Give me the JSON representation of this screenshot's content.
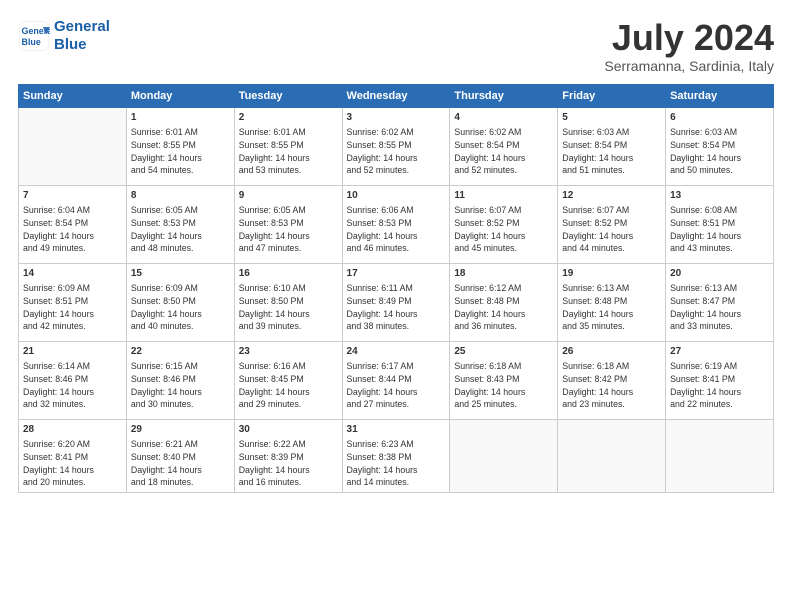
{
  "logo": {
    "line1": "General",
    "line2": "Blue"
  },
  "title": "July 2024",
  "subtitle": "Serramanna, Sardinia, Italy",
  "headers": [
    "Sunday",
    "Monday",
    "Tuesday",
    "Wednesday",
    "Thursday",
    "Friday",
    "Saturday"
  ],
  "weeks": [
    [
      {
        "day": "",
        "text": ""
      },
      {
        "day": "1",
        "text": "Sunrise: 6:01 AM\nSunset: 8:55 PM\nDaylight: 14 hours\nand 54 minutes."
      },
      {
        "day": "2",
        "text": "Sunrise: 6:01 AM\nSunset: 8:55 PM\nDaylight: 14 hours\nand 53 minutes."
      },
      {
        "day": "3",
        "text": "Sunrise: 6:02 AM\nSunset: 8:55 PM\nDaylight: 14 hours\nand 52 minutes."
      },
      {
        "day": "4",
        "text": "Sunrise: 6:02 AM\nSunset: 8:54 PM\nDaylight: 14 hours\nand 52 minutes."
      },
      {
        "day": "5",
        "text": "Sunrise: 6:03 AM\nSunset: 8:54 PM\nDaylight: 14 hours\nand 51 minutes."
      },
      {
        "day": "6",
        "text": "Sunrise: 6:03 AM\nSunset: 8:54 PM\nDaylight: 14 hours\nand 50 minutes."
      }
    ],
    [
      {
        "day": "7",
        "text": "Sunrise: 6:04 AM\nSunset: 8:54 PM\nDaylight: 14 hours\nand 49 minutes."
      },
      {
        "day": "8",
        "text": "Sunrise: 6:05 AM\nSunset: 8:53 PM\nDaylight: 14 hours\nand 48 minutes."
      },
      {
        "day": "9",
        "text": "Sunrise: 6:05 AM\nSunset: 8:53 PM\nDaylight: 14 hours\nand 47 minutes."
      },
      {
        "day": "10",
        "text": "Sunrise: 6:06 AM\nSunset: 8:53 PM\nDaylight: 14 hours\nand 46 minutes."
      },
      {
        "day": "11",
        "text": "Sunrise: 6:07 AM\nSunset: 8:52 PM\nDaylight: 14 hours\nand 45 minutes."
      },
      {
        "day": "12",
        "text": "Sunrise: 6:07 AM\nSunset: 8:52 PM\nDaylight: 14 hours\nand 44 minutes."
      },
      {
        "day": "13",
        "text": "Sunrise: 6:08 AM\nSunset: 8:51 PM\nDaylight: 14 hours\nand 43 minutes."
      }
    ],
    [
      {
        "day": "14",
        "text": "Sunrise: 6:09 AM\nSunset: 8:51 PM\nDaylight: 14 hours\nand 42 minutes."
      },
      {
        "day": "15",
        "text": "Sunrise: 6:09 AM\nSunset: 8:50 PM\nDaylight: 14 hours\nand 40 minutes."
      },
      {
        "day": "16",
        "text": "Sunrise: 6:10 AM\nSunset: 8:50 PM\nDaylight: 14 hours\nand 39 minutes."
      },
      {
        "day": "17",
        "text": "Sunrise: 6:11 AM\nSunset: 8:49 PM\nDaylight: 14 hours\nand 38 minutes."
      },
      {
        "day": "18",
        "text": "Sunrise: 6:12 AM\nSunset: 8:48 PM\nDaylight: 14 hours\nand 36 minutes."
      },
      {
        "day": "19",
        "text": "Sunrise: 6:13 AM\nSunset: 8:48 PM\nDaylight: 14 hours\nand 35 minutes."
      },
      {
        "day": "20",
        "text": "Sunrise: 6:13 AM\nSunset: 8:47 PM\nDaylight: 14 hours\nand 33 minutes."
      }
    ],
    [
      {
        "day": "21",
        "text": "Sunrise: 6:14 AM\nSunset: 8:46 PM\nDaylight: 14 hours\nand 32 minutes."
      },
      {
        "day": "22",
        "text": "Sunrise: 6:15 AM\nSunset: 8:46 PM\nDaylight: 14 hours\nand 30 minutes."
      },
      {
        "day": "23",
        "text": "Sunrise: 6:16 AM\nSunset: 8:45 PM\nDaylight: 14 hours\nand 29 minutes."
      },
      {
        "day": "24",
        "text": "Sunrise: 6:17 AM\nSunset: 8:44 PM\nDaylight: 14 hours\nand 27 minutes."
      },
      {
        "day": "25",
        "text": "Sunrise: 6:18 AM\nSunset: 8:43 PM\nDaylight: 14 hours\nand 25 minutes."
      },
      {
        "day": "26",
        "text": "Sunrise: 6:18 AM\nSunset: 8:42 PM\nDaylight: 14 hours\nand 23 minutes."
      },
      {
        "day": "27",
        "text": "Sunrise: 6:19 AM\nSunset: 8:41 PM\nDaylight: 14 hours\nand 22 minutes."
      }
    ],
    [
      {
        "day": "28",
        "text": "Sunrise: 6:20 AM\nSunset: 8:41 PM\nDaylight: 14 hours\nand 20 minutes."
      },
      {
        "day": "29",
        "text": "Sunrise: 6:21 AM\nSunset: 8:40 PM\nDaylight: 14 hours\nand 18 minutes."
      },
      {
        "day": "30",
        "text": "Sunrise: 6:22 AM\nSunset: 8:39 PM\nDaylight: 14 hours\nand 16 minutes."
      },
      {
        "day": "31",
        "text": "Sunrise: 6:23 AM\nSunset: 8:38 PM\nDaylight: 14 hours\nand 14 minutes."
      },
      {
        "day": "",
        "text": ""
      },
      {
        "day": "",
        "text": ""
      },
      {
        "day": "",
        "text": ""
      }
    ]
  ]
}
